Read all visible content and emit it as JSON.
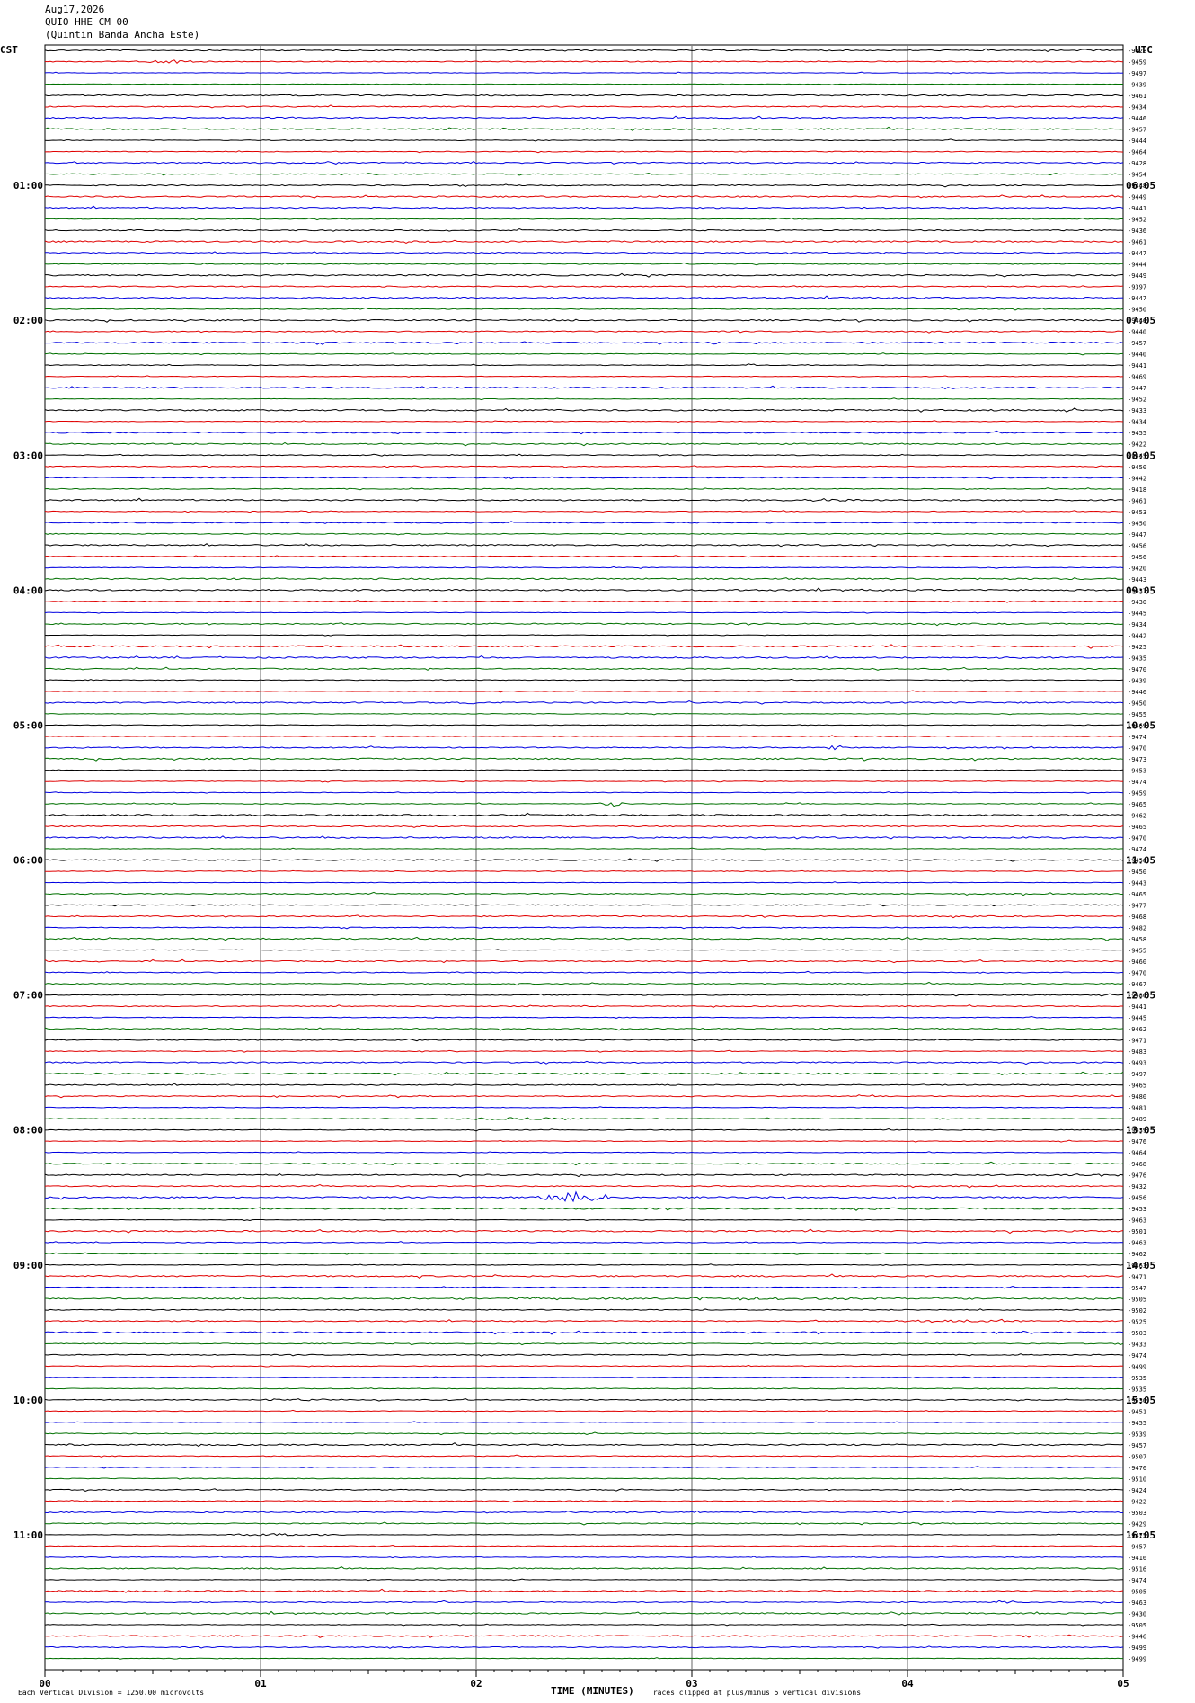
{
  "header": {
    "date": "Aug17,2026",
    "station": "QUIO HHE CM 00",
    "location": "(Quintin Banda Ancha Este)"
  },
  "left_zone": "CST",
  "right_zone": "UTC",
  "footer": {
    "scale_note": "Each Vertical Division = 1250.00 microvolts",
    "x_title": "TIME (MINUTES)",
    "clip_note": "Traces clipped at plus/minus 5 vertical divisions"
  },
  "colors": {
    "black": "#000000",
    "red": "#e00000",
    "blue": "#0000e0",
    "green": "#007000",
    "grid": "#808080"
  },
  "chart_data": {
    "type": "line",
    "xlabel": "TIME (MINUTES)",
    "x_ticks": [
      "00",
      "01",
      "02",
      "03",
      "04",
      "05"
    ],
    "xlim": [
      0,
      5
    ],
    "trace_count": 144,
    "traces_per_hour": 12,
    "color_cycle": [
      "black",
      "red",
      "blue",
      "green"
    ],
    "left_hour_labels": [
      "01:00",
      "02:00",
      "03:00",
      "04:00",
      "05:00",
      "06:00",
      "07:00",
      "08:00",
      "09:00",
      "10:00",
      "11:00"
    ],
    "right_hour_labels": [
      "06:05",
      "07:05",
      "08:05",
      "09:05",
      "10:05",
      "11:05",
      "12:05",
      "13:05",
      "14:05",
      "15:05",
      "16:05"
    ],
    "right_values": [
      "-9428",
      "-9459",
      "-9497",
      "-9439",
      "-9461",
      "-9434",
      "-9446",
      "-9457",
      "-9444",
      "-9464",
      "-9428",
      "-9454",
      "-9448",
      "-9449",
      "-9441",
      "-9452",
      "-9436",
      "-9461",
      "-9447",
      "-9444",
      "-9449",
      "-9397",
      "-9447",
      "-9450",
      "-9446",
      "-9440",
      "-9457",
      "-9440",
      "-9441",
      "-9469",
      "-9447",
      "-9452",
      "-9433",
      "-9434",
      "-9455",
      "-9422",
      "-9445",
      "-9450",
      "-9442",
      "-9418",
      "-9461",
      "-9453",
      "-9450",
      "-9447",
      "-9456",
      "-9456",
      "-9420",
      "-9443",
      "-9437",
      "-9430",
      "-9445",
      "-9434",
      "-9442",
      "-9425",
      "-9435",
      "-9470",
      "-9439",
      "-9446",
      "-9450",
      "-9455",
      "-9469",
      "-9474",
      "-9470",
      "-9473",
      "-9453",
      "-9474",
      "-9459",
      "-9465",
      "-9462",
      "-9465",
      "-9470",
      "-9474",
      "-9456",
      "-9450",
      "-9443",
      "-9465",
      "-9477",
      "-9468",
      "-9482",
      "-9458",
      "-9455",
      "-9460",
      "-9470",
      "-9467",
      "-9480",
      "-9441",
      "-9445",
      "-9462",
      "-9471",
      "-9483",
      "-9493",
      "-9497",
      "-9465",
      "-9480",
      "-9481",
      "-9489",
      "-9439",
      "-9476",
      "-9464",
      "-9468",
      "-9476",
      "-9432",
      "-9456",
      "-9453",
      "-9463",
      "-9501",
      "-9463",
      "-9462",
      "-9463",
      "-9471",
      "-9547",
      "-9505",
      "-9502",
      "-9525",
      "-9503",
      "-9433",
      "-9474",
      "-9499",
      "-9535",
      "-9535",
      "-9530",
      "-9451",
      "-9455",
      "-9539",
      "-9457",
      "-9507",
      "-9476",
      "-9510",
      "-9424",
      "-9422",
      "-9503",
      "-9429",
      "-9475",
      "-9457",
      "-9416",
      "-9516",
      "-9474",
      "-9505",
      "-9463",
      "-9430",
      "-9505",
      "-9446",
      "-9499",
      "-9499"
    ],
    "events": [
      {
        "trace": 0,
        "start": 4.75,
        "end": 4.92,
        "amp": 1.0
      },
      {
        "trace": 1,
        "start": 0.4,
        "end": 0.8,
        "amp": 1.2
      },
      {
        "trace": 24,
        "start": 2.35,
        "end": 2.5,
        "amp": 2.0
      },
      {
        "trace": 28,
        "start": 3.2,
        "end": 3.3,
        "amp": 2.0
      },
      {
        "trace": 40,
        "start": 3.4,
        "end": 3.9,
        "amp": 1.0
      },
      {
        "trace": 58,
        "start": 1.9,
        "end": 2.1,
        "amp": 0.8
      },
      {
        "trace": 62,
        "start": 3.6,
        "end": 3.75,
        "amp": 2.0
      },
      {
        "trace": 67,
        "start": 2.55,
        "end": 2.7,
        "amp": 2.0
      },
      {
        "trace": 95,
        "start": 1.9,
        "end": 2.6,
        "amp": 1.0
      },
      {
        "trace": 100,
        "start": 4.55,
        "end": 5.0,
        "amp": 1.2
      },
      {
        "trace": 102,
        "start": 2.25,
        "end": 2.65,
        "amp": 4.5
      },
      {
        "trace": 111,
        "start": 1.5,
        "end": 4.5,
        "amp": 0.9
      },
      {
        "trace": 113,
        "start": 3.8,
        "end": 4.6,
        "amp": 1.0
      },
      {
        "trace": 120,
        "start": 1.0,
        "end": 1.4,
        "amp": 0.9
      },
      {
        "trace": 130,
        "start": 2.6,
        "end": 3.0,
        "amp": 0.9
      },
      {
        "trace": 132,
        "start": 0.8,
        "end": 1.4,
        "amp": 0.9
      },
      {
        "trace": 138,
        "start": 4.4,
        "end": 4.5,
        "amp": 1.5
      }
    ]
  }
}
